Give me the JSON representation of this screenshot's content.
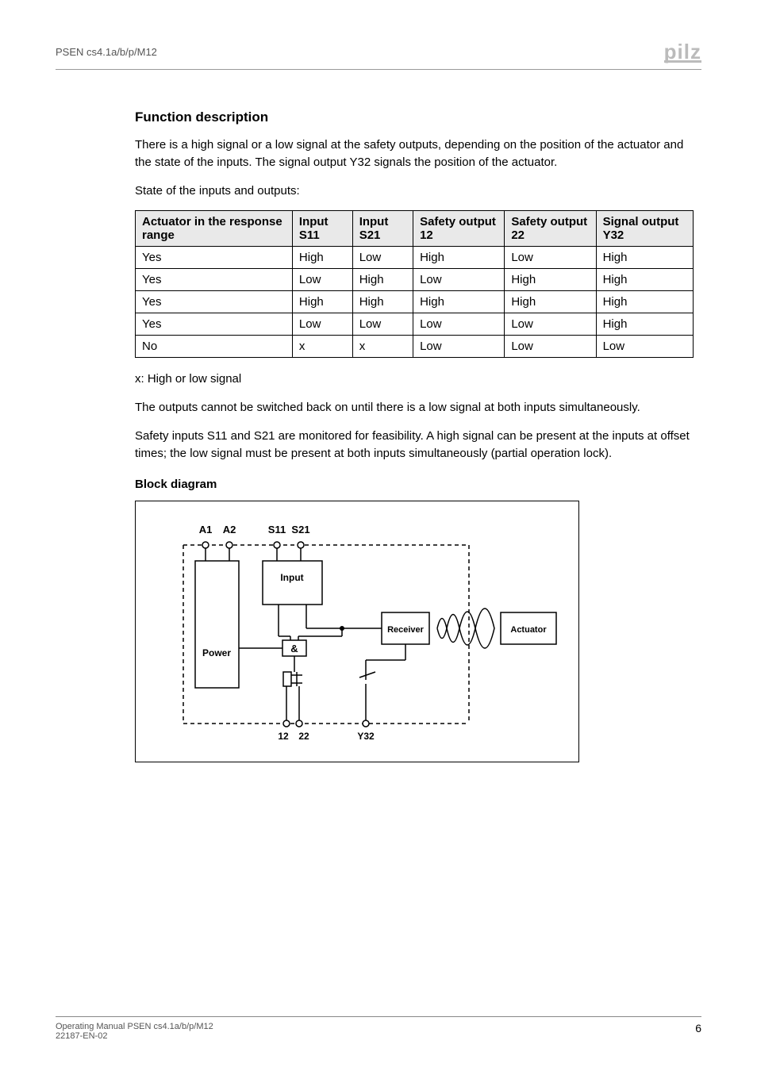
{
  "header": {
    "doc_id": "PSEN cs4.1a/b/p/M12",
    "logo": "pilz"
  },
  "section": {
    "title": "Function description",
    "intro": "There is a high signal or a low signal at the safety outputs, depending on the position of the actuator and the state of the inputs. The signal output Y32 signals the position of the actuator.",
    "state_lead": "State of the inputs and outputs:"
  },
  "table": {
    "headers": {
      "c0": "Actuator in the response range",
      "c1": "Input S11",
      "c2": "Input S21",
      "c3": "Safety output 12",
      "c4": "Safety output 22",
      "c5": "Signal output Y32"
    },
    "rows": [
      {
        "c0": "Yes",
        "c1": "High",
        "c2": "Low",
        "c3": "High",
        "c4": "Low",
        "c5": "High"
      },
      {
        "c0": "Yes",
        "c1": "Low",
        "c2": "High",
        "c3": "Low",
        "c4": "High",
        "c5": "High"
      },
      {
        "c0": "Yes",
        "c1": "High",
        "c2": "High",
        "c3": "High",
        "c4": "High",
        "c5": "High"
      },
      {
        "c0": "Yes",
        "c1": "Low",
        "c2": "Low",
        "c3": "Low",
        "c4": "Low",
        "c5": "High"
      },
      {
        "c0": "No",
        "c1": "x",
        "c2": "x",
        "c3": "Low",
        "c4": "Low",
        "c5": "Low"
      }
    ]
  },
  "notes": {
    "x_note": "x: High or low signal",
    "p1": "The outputs cannot be switched back on until there is a low signal at both inputs simultaneously.",
    "p2": "Safety inputs S11 and S21 are monitored for feasibility. A high signal can be present at the inputs at offset times; the low signal must be present at both inputs simultaneously (partial operation lock)."
  },
  "block": {
    "heading": "Block diagram",
    "labels": {
      "A1": "A1",
      "A2": "A2",
      "S11": "S11",
      "S21": "S21",
      "Input": "Input",
      "Power": "Power",
      "Receiver": "Receiver",
      "Actuator": "Actuator",
      "amp": "&",
      "o12": "12",
      "o22": "22",
      "Y32": "Y32"
    }
  },
  "footer": {
    "line1": "Operating Manual PSEN cs4.1a/b/p/M12",
    "line2": "22187-EN-02",
    "page": "6"
  }
}
